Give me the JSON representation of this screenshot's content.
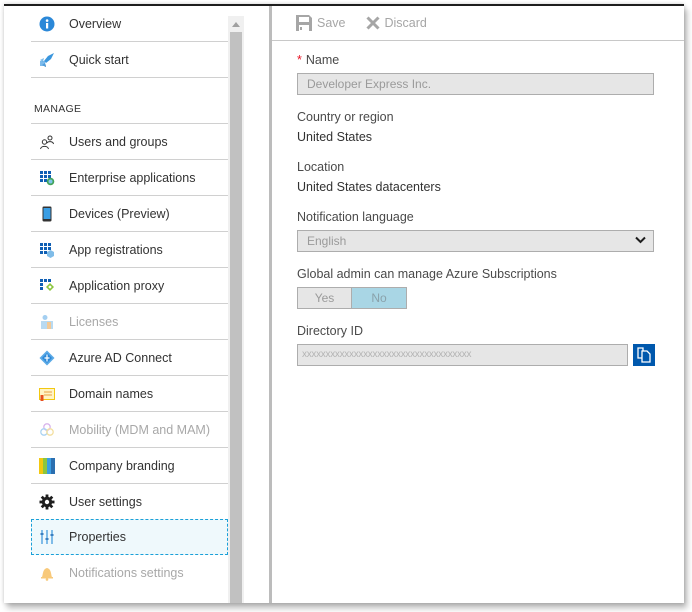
{
  "sidebar": {
    "top_items": [
      {
        "label": "Overview",
        "icon": "info-icon",
        "disabled": false
      },
      {
        "label": "Quick start",
        "icon": "rocket-icon",
        "disabled": false
      }
    ],
    "section_label": "MANAGE",
    "manage_items": [
      {
        "label": "Users and groups",
        "icon": "users-icon",
        "disabled": false
      },
      {
        "label": "Enterprise applications",
        "icon": "enterprise-apps-icon",
        "disabled": false
      },
      {
        "label": "Devices (Preview)",
        "icon": "device-icon",
        "disabled": false
      },
      {
        "label": "App registrations",
        "icon": "app-registrations-icon",
        "disabled": false
      },
      {
        "label": "Application proxy",
        "icon": "application-proxy-icon",
        "disabled": false
      },
      {
        "label": "Licenses",
        "icon": "licenses-icon",
        "disabled": true
      },
      {
        "label": "Azure AD Connect",
        "icon": "azure-ad-connect-icon",
        "disabled": false
      },
      {
        "label": "Domain names",
        "icon": "domain-names-icon",
        "disabled": false
      },
      {
        "label": "Mobility (MDM and MAM)",
        "icon": "mobility-icon",
        "disabled": true
      },
      {
        "label": "Company branding",
        "icon": "branding-icon",
        "disabled": false
      },
      {
        "label": "User settings",
        "icon": "gear-icon",
        "disabled": false
      },
      {
        "label": "Properties",
        "icon": "properties-sliders-icon",
        "disabled": false,
        "selected": true
      },
      {
        "label": "Notifications settings",
        "icon": "bell-icon",
        "disabled": true
      }
    ]
  },
  "toolbar": {
    "save_label": "Save",
    "discard_label": "Discard"
  },
  "form": {
    "name": {
      "label": "Name",
      "required_marker": "*",
      "value": "Developer Express Inc."
    },
    "country": {
      "label": "Country or region",
      "value": "United States"
    },
    "location": {
      "label": "Location",
      "value": "United States datacenters"
    },
    "notification_language": {
      "label": "Notification language",
      "selected": "English"
    },
    "global_admin": {
      "label": "Global admin can manage Azure Subscriptions",
      "options": [
        "Yes",
        "No"
      ],
      "selected": "No"
    },
    "directory_id": {
      "label": "Directory ID",
      "value": "xxxxxxxxxxxxxxxxxxxxxxxxxxxxxxxxxxxx"
    }
  },
  "colors": {
    "accent": "#0058ad",
    "selected_toggle": "#a9d6e5",
    "selection_outline": "#1aa0d8",
    "required": "#e81123"
  }
}
